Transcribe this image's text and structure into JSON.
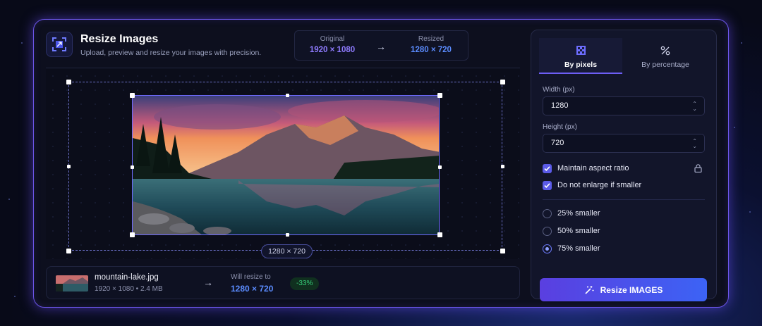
{
  "header": {
    "title": "Resize Images",
    "subtitle": "Upload, preview and resize your images with precision."
  },
  "comparison": {
    "original_label": "Original",
    "original_value": "1920 × 1080",
    "resized_label": "Resized",
    "resized_value": "1280 × 720"
  },
  "preview": {
    "dimension_badge": "1280 × 720"
  },
  "file": {
    "name": "mountain-lake.jpg",
    "meta": "1920 × 1080 • 2.4 MB",
    "will_resize_label": "Will resize to",
    "will_resize_value": "1280 × 720",
    "percent_change": "-33%"
  },
  "panel": {
    "tabs": [
      {
        "label": "By pixels",
        "active": true
      },
      {
        "label": "By percentage",
        "active": false
      }
    ],
    "width_label": "Width (px)",
    "width_value": "1280",
    "height_label": "Height (px)",
    "height_value": "720",
    "checkboxes": [
      {
        "label": "Maintain aspect ratio",
        "checked": true
      },
      {
        "label": "Do not enlarge if smaller",
        "checked": true
      }
    ],
    "radios": [
      {
        "label": "25% smaller",
        "selected": false
      },
      {
        "label": "50% smaller",
        "selected": false
      },
      {
        "label": "75% smaller",
        "selected": true
      }
    ],
    "button_label": "Resize IMAGES"
  },
  "colors": {
    "accent": "#6d5ef5",
    "resized_blue": "#5b8cff",
    "original_purple": "#8f7bff",
    "success_green": "#37d07a"
  },
  "icons": [
    "resize-frame-icon",
    "arrow-right-icon",
    "pixel-grid-icon",
    "percent-icon",
    "lock-icon",
    "check-icon",
    "magic-wand-icon"
  ]
}
